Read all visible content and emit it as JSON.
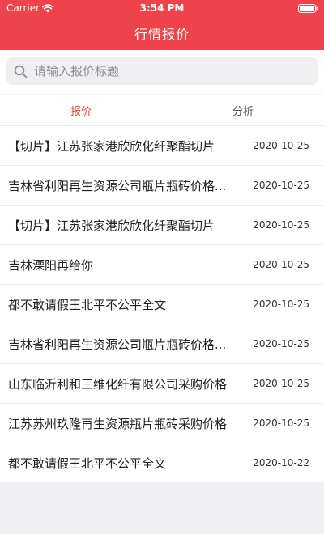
{
  "status_bar": {
    "carrier": "Carrier",
    "time": "3:54 PM"
  },
  "header": {
    "title": "行情报价",
    "background": "#ee434a"
  },
  "search": {
    "placeholder": "请输入报价标题",
    "value": ""
  },
  "tabs": [
    {
      "label": "报价",
      "active": true
    },
    {
      "label": "分析",
      "active": false
    }
  ],
  "accent_color": "#e4393c",
  "list": {
    "items": [
      {
        "title": "【切片】江苏张家港欣欣化纤聚酯切片",
        "date": "2020-10-25"
      },
      {
        "title": "吉林省利阳再生资源公司瓶片瓶砖价格...",
        "date": "2020-10-25"
      },
      {
        "title": "【切片】江苏张家港欣欣化纤聚酯切片",
        "date": "2020-10-25"
      },
      {
        "title": "吉林溧阳再给你",
        "date": "2020-10-25"
      },
      {
        "title": "都不敢请假王北平不公平全文",
        "date": "2020-10-25"
      },
      {
        "title": "吉林省利阳再生资源公司瓶片瓶砖价格...",
        "date": "2020-10-25"
      },
      {
        "title": "山东临沂利和三维化纤有限公司采购价格",
        "date": "2020-10-25"
      },
      {
        "title": "江苏苏州玖隆再生资源瓶片瓶砖采购价格",
        "date": "2020-10-25"
      },
      {
        "title": "都不敢请假王北平不公平全文",
        "date": "2020-10-22"
      }
    ]
  },
  "icons": {
    "wifi": "wifi-icon",
    "battery": "battery-icon",
    "search": "search-icon"
  }
}
